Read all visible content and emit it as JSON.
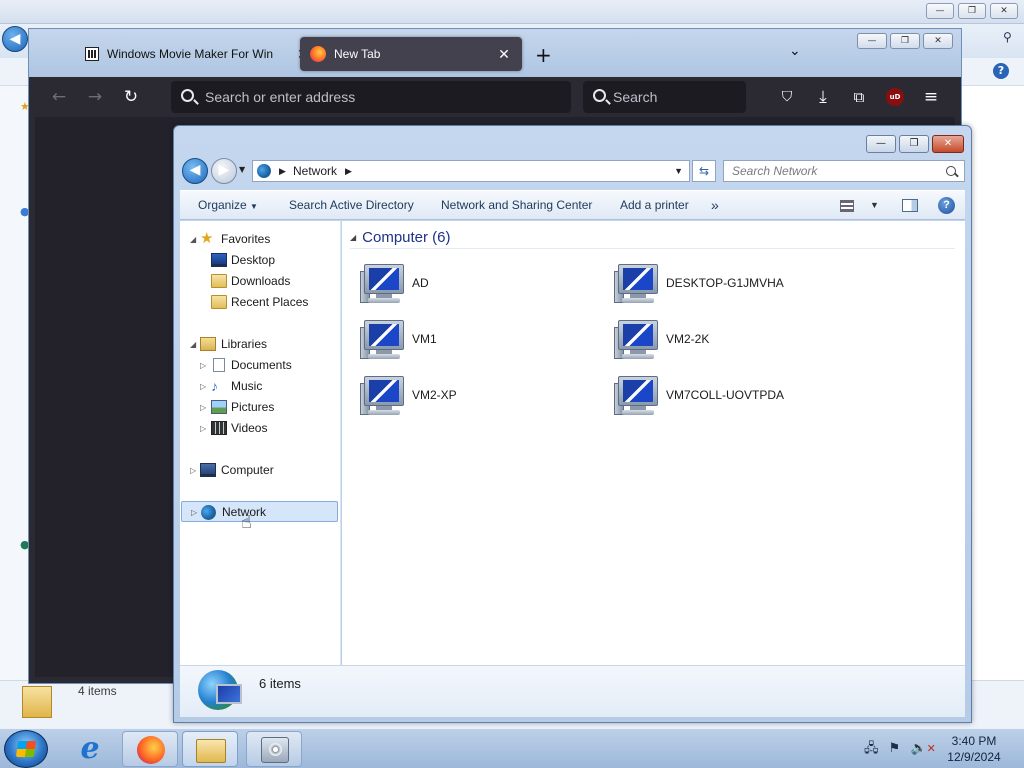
{
  "firefox": {
    "tabs": [
      {
        "label": "Windows Movie Maker For Win",
        "active": false
      },
      {
        "label": "New Tab",
        "active": true
      }
    ],
    "address_placeholder": "Search or enter address",
    "search_placeholder": "Search",
    "ublock_badge": "uD"
  },
  "explorer": {
    "breadcrumb": "Network",
    "search_placeholder": "Search Network",
    "toolbar": {
      "organize": "Organize",
      "search_ad": "Search Active Directory",
      "network_sharing": "Network and Sharing Center",
      "add_printer": "Add a printer",
      "more": "»",
      "help": "?"
    },
    "nav": {
      "favorites": "Favorites",
      "desktop": "Desktop",
      "downloads": "Downloads",
      "recent_places": "Recent Places",
      "libraries": "Libraries",
      "documents": "Documents",
      "music": "Music",
      "pictures": "Pictures",
      "videos": "Videos",
      "computer": "Computer",
      "network": "Network"
    },
    "group_header": "Computer (6)",
    "computers": [
      "AD",
      "DESKTOP-G1JMVHA",
      "VM1",
      "VM2-2K",
      "VM2-XP",
      "VM7COLL-UOVTPDA"
    ],
    "status": "6 items"
  },
  "background_window": {
    "status": "4 items"
  },
  "taskbar": {
    "time": "3:40 PM",
    "date": "12/9/2024"
  },
  "colors": {
    "firefox_dark": "#2b2a33",
    "explorer_frame": "#b6cbe6",
    "group_header": "#1e3287",
    "selected_nav": "#d5e6fb"
  }
}
